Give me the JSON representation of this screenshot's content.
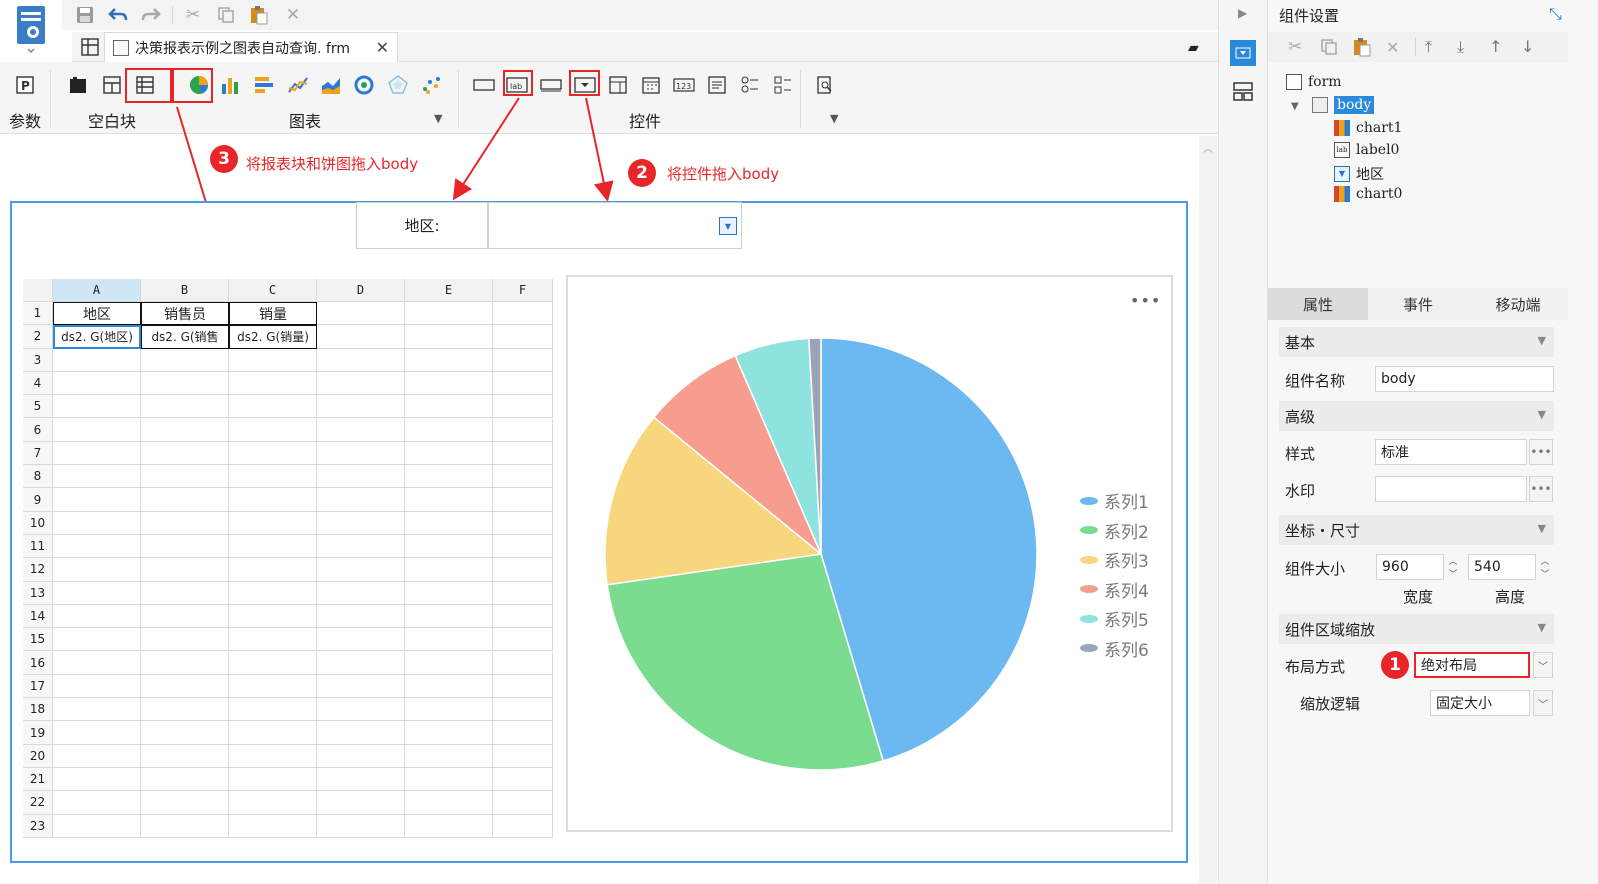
{
  "file_tab": {
    "title": "决策报表示例之图表自动查询. frm"
  },
  "ribbon": {
    "param_label": "参数",
    "blank_label": "空白块",
    "chart_label": "图表",
    "control_label": "控件"
  },
  "annotations": {
    "step1_num": "1",
    "step2_num": "2",
    "step2_text": "将控件拖入body",
    "step3_num": "3",
    "step3_text": "将报表块和饼图拖入body"
  },
  "canvas": {
    "label_text": "地区:"
  },
  "grid": {
    "columns": [
      "A",
      "B",
      "C",
      "D",
      "E",
      "F"
    ],
    "rows": [
      "1",
      "2",
      "3",
      "4",
      "5",
      "6",
      "7",
      "8",
      "9",
      "10",
      "11",
      "12",
      "13",
      "14",
      "15",
      "16",
      "17",
      "18",
      "19",
      "20",
      "21",
      "22",
      "23"
    ],
    "header_row": [
      "地区",
      "销售员",
      "销量"
    ],
    "data_row": [
      "ds2. G(地区)",
      "ds2. G(销售",
      "ds2. G(销量)"
    ]
  },
  "chart_data": {
    "type": "pie",
    "categories": [
      "系列1",
      "系列2",
      "系列3",
      "系列4",
      "系列5",
      "系列6"
    ],
    "values": [
      45.4,
      27.4,
      13.2,
      7.6,
      5.6,
      0.9
    ],
    "colors": [
      "#6cb8f0",
      "#7bdb8f",
      "#f8d67e",
      "#f79d8f",
      "#8fe3de",
      "#9aa3b8"
    ],
    "legend": "right"
  },
  "chart_menu": "•••",
  "right_panel": {
    "title": "组件设置",
    "tree": [
      "form",
      "body",
      "chart1",
      "label0",
      "地区",
      "chart0"
    ],
    "tabs": [
      "属性",
      "事件",
      "移动端"
    ],
    "sections": {
      "basic": "基本",
      "advanced": "高级",
      "position_size": "坐标・尺寸",
      "scale": "组件区域缩放"
    },
    "props": {
      "name_label": "组件名称",
      "name_value": "body",
      "style_label": "样式",
      "style_value": "标准",
      "watermark_label": "水印",
      "size_label": "组件大小",
      "width_value": "960",
      "height_value": "540",
      "width_caption": "宽度",
      "height_caption": "高度",
      "layout_label": "布局方式",
      "layout_value": "绝对布局",
      "scale_label": "缩放逻辑",
      "scale_value": "固定大小"
    }
  }
}
